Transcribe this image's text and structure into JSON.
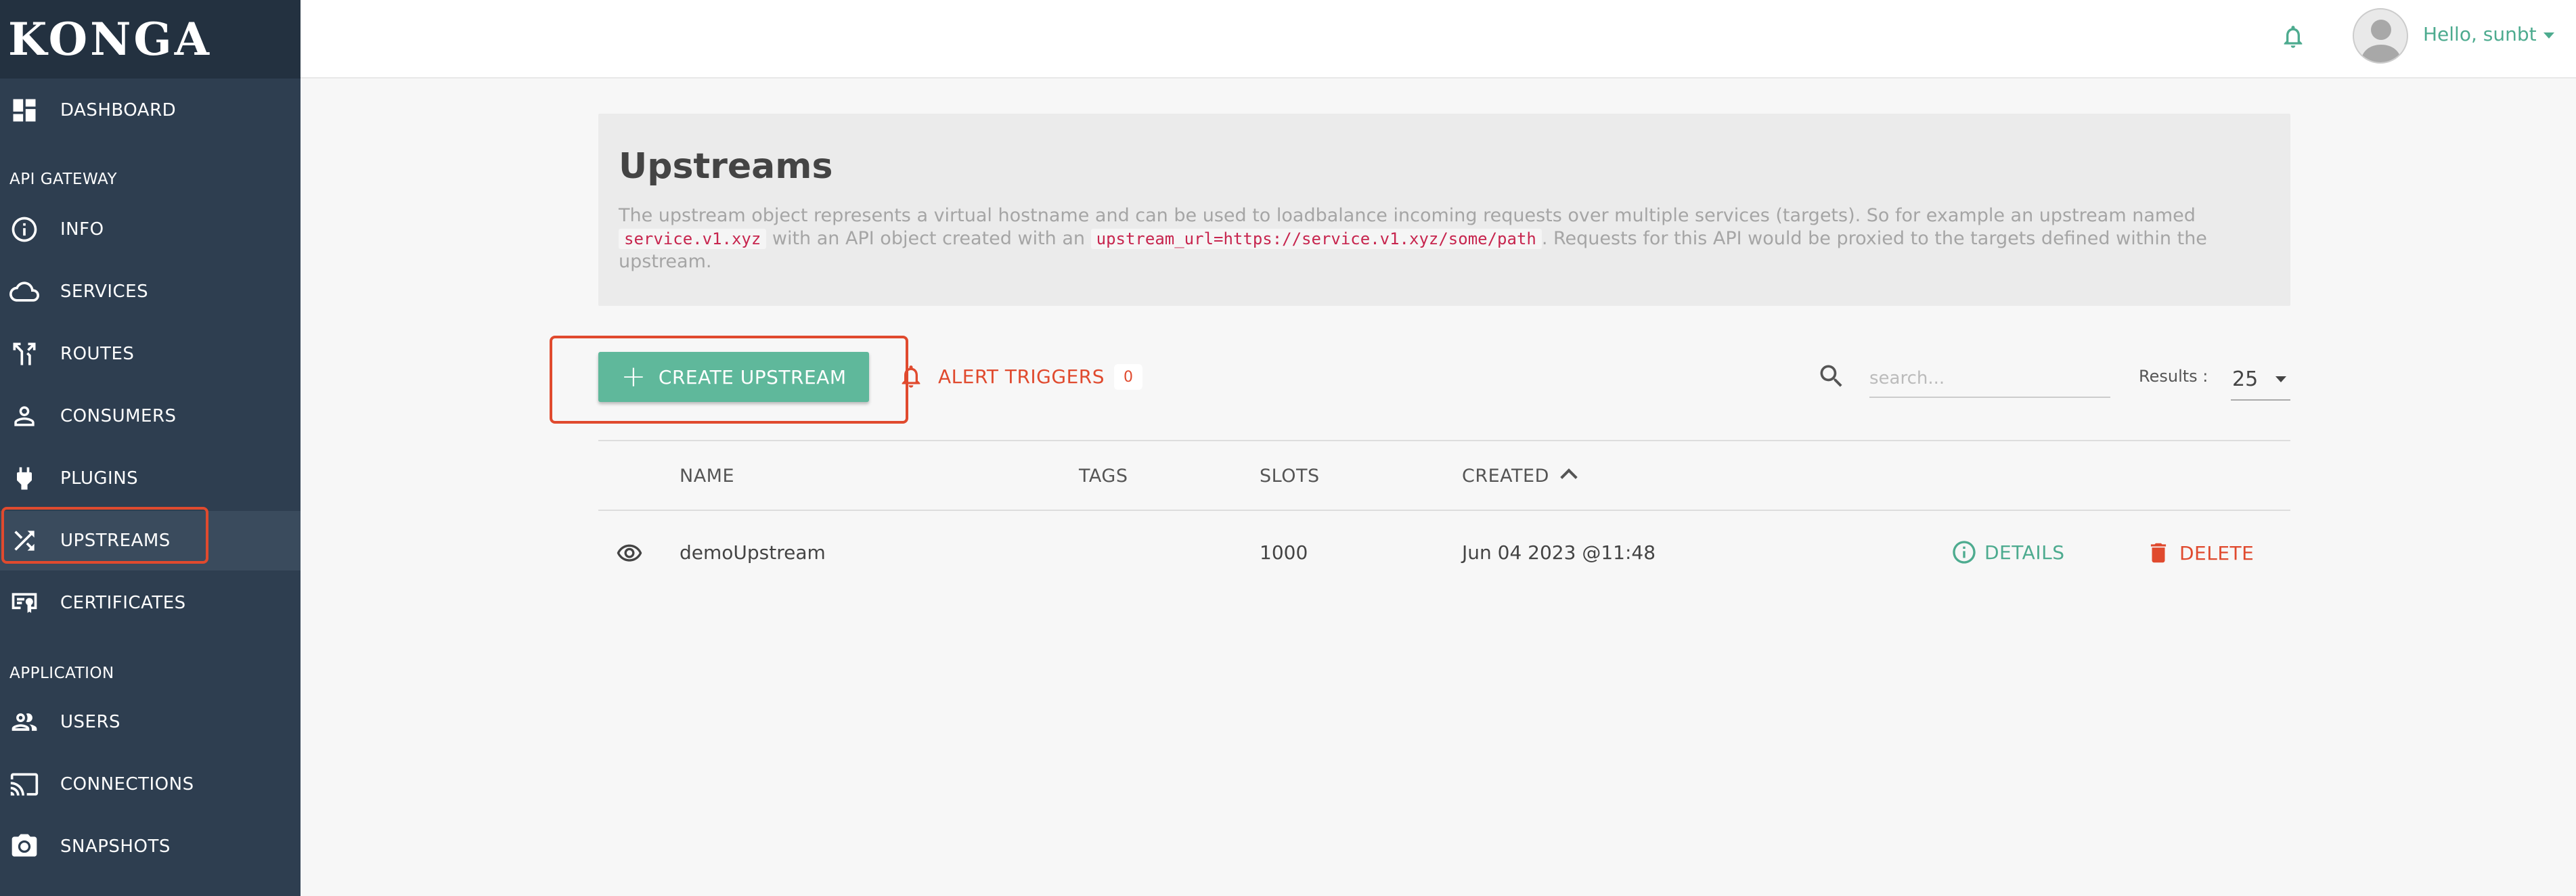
{
  "app": {
    "logo": "KONGA"
  },
  "sidebar": {
    "sections": {
      "api_gateway": "API GATEWAY",
      "application": "APPLICATION"
    },
    "items": [
      {
        "label": "DASHBOARD",
        "icon": "dashboard-icon"
      },
      {
        "label": "INFO",
        "icon": "info-icon"
      },
      {
        "label": "SERVICES",
        "icon": "cloud-icon"
      },
      {
        "label": "ROUTES",
        "icon": "routes-icon"
      },
      {
        "label": "CONSUMERS",
        "icon": "user-icon"
      },
      {
        "label": "PLUGINS",
        "icon": "plug-icon"
      },
      {
        "label": "UPSTREAMS",
        "icon": "shuffle-icon",
        "active": true
      },
      {
        "label": "CERTIFICATES",
        "icon": "certificate-icon"
      },
      {
        "label": "USERS",
        "icon": "users-icon"
      },
      {
        "label": "CONNECTIONS",
        "icon": "cast-icon"
      },
      {
        "label": "SNAPSHOTS",
        "icon": "camera-icon"
      }
    ]
  },
  "header": {
    "greeting": "Hello, sunbt"
  },
  "page": {
    "title": "Upstreams",
    "desc_1": "The upstream object represents a virtual hostname and can be used to loadbalance incoming requests over multiple services (targets). So for example an upstream named",
    "code_1": "service.v1.xyz",
    "desc_2": "with an API object created with an",
    "code_2": "upstream_url=https://service.v1.xyz/some/path",
    "desc_3": ". Requests for this API would be proxied to the targets defined within the upstream."
  },
  "toolbar": {
    "create_label": "CREATE UPSTREAM",
    "alert_label": "ALERT TRIGGERS",
    "alert_count": "0",
    "search_placeholder": "search...",
    "results_label": "Results :",
    "results_value": "25"
  },
  "table": {
    "columns": [
      "NAME",
      "TAGS",
      "SLOTS",
      "CREATED"
    ],
    "rows": [
      {
        "name": "demoUpstream",
        "tags": "",
        "slots": "1000",
        "created": "Jun 04 2023 @11:48",
        "details": "DETAILS",
        "delete": "DELETE"
      }
    ]
  },
  "colors": {
    "sidebar": "#2e3e50",
    "accent": "#5fb89b",
    "danger": "#e04a2e",
    "highlight": "#e04a2e"
  }
}
